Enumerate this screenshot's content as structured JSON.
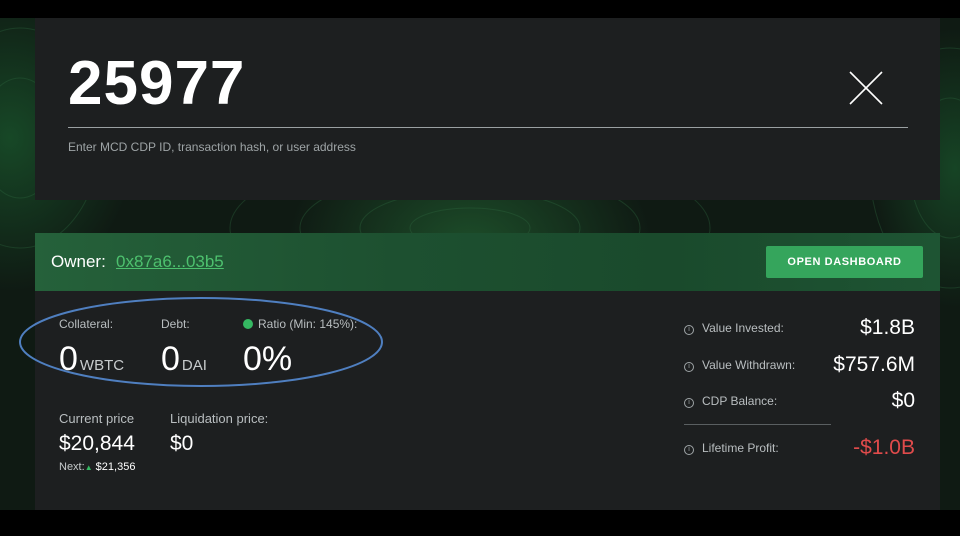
{
  "search": {
    "value": "25977",
    "hint": "Enter MCD CDP ID, transaction hash, or user address",
    "close_icon": "close-icon"
  },
  "owner": {
    "label": "Owner:",
    "address": "0x87a6...03b5",
    "button_label": "OPEN DASHBOARD"
  },
  "stats": {
    "collateral": {
      "label": "Collateral:",
      "value": "0",
      "unit": "WBTC"
    },
    "debt": {
      "label": "Debt:",
      "value": "0",
      "unit": "DAI"
    },
    "ratio": {
      "label": "Ratio (Min: 145%):",
      "value": "0%",
      "status_color": "#35b862"
    }
  },
  "prices": {
    "current": {
      "label": "Current price",
      "value": "$20,844"
    },
    "next": {
      "label": "Next:",
      "value": "$21,356"
    },
    "liquidation": {
      "label": "Liquidation price:",
      "value": "$0"
    }
  },
  "summary": {
    "invested": {
      "label": "Value Invested:",
      "value": "$1.8B"
    },
    "withdrawn": {
      "label": "Value Withdrawn:",
      "value": "$757.6M"
    },
    "balance": {
      "label": "CDP Balance:",
      "value": "$0"
    },
    "profit": {
      "label": "Lifetime Profit:",
      "value": "-$1.0B",
      "color": "#e04b4b"
    }
  },
  "colors": {
    "accent": "#35a55c",
    "link": "#4dc06e",
    "annotation": "#4f7fc0"
  }
}
